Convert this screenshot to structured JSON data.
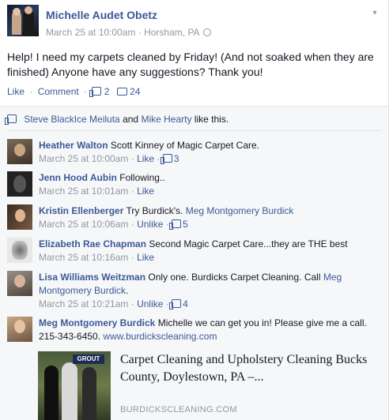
{
  "post": {
    "author": "Michelle Audet Obetz",
    "date": "March 25 at 10:00am",
    "location": "Horsham, PA",
    "text": "Help! I need my carpets cleaned by Friday! (And not soaked when they are finished) Anyone have any suggestions? Thank you!",
    "like_label": "Like",
    "comment_label": "Comment",
    "like_count": "2",
    "comment_count": "24"
  },
  "likes": {
    "person1": "Steve BlackIce Meiluta",
    "and": "and",
    "person2": "Mike Hearty",
    "suffix": "like this."
  },
  "comments": [
    {
      "name": "Heather Walton",
      "text": "Scott Kinney of Magic Carpet Care.",
      "time": "March 25 at 10:00am",
      "action": "Like",
      "count": "3"
    },
    {
      "name": "Jenn Hood Aubin",
      "text": "Following..",
      "time": "March 25 at 10:01am",
      "action": "Like",
      "count": ""
    },
    {
      "name": "Kristin Ellenberger",
      "text": "Try Burdick's.",
      "mention": "Meg Montgomery Burdick",
      "time": "March 25 at 10:06am",
      "action": "Unlike",
      "count": "5"
    },
    {
      "name": "Elizabeth Rae Chapman",
      "text": "Second Magic Carpet Care...they are THE best",
      "time": "March 25 at 10:16am",
      "action": "Like",
      "count": ""
    },
    {
      "name": "Lisa Williams Weitzman",
      "text": "Only one. Burdicks Carpet Cleaning. Call",
      "mention": "Meg Montgomery Burdick",
      "after": ".",
      "time": "March 25 at 10:21am",
      "action": "Unlike",
      "count": "4"
    },
    {
      "name": "Meg Montgomery Burdick",
      "text": "Michelle we can get you in! Please give me a call. 215-343-6450.",
      "link": "www.burdickscleaning.com"
    }
  ],
  "share": {
    "title": "Carpet Cleaning and Upholstery Cleaning Bucks County, Doylestown, PA –...",
    "domain": "BURDICKSCLEANING.COM",
    "image_sign": "GROUT"
  },
  "colors": {
    "link": "#3b5998",
    "meta": "#9197a3",
    "ufi_bg": "#f6f7f8"
  }
}
